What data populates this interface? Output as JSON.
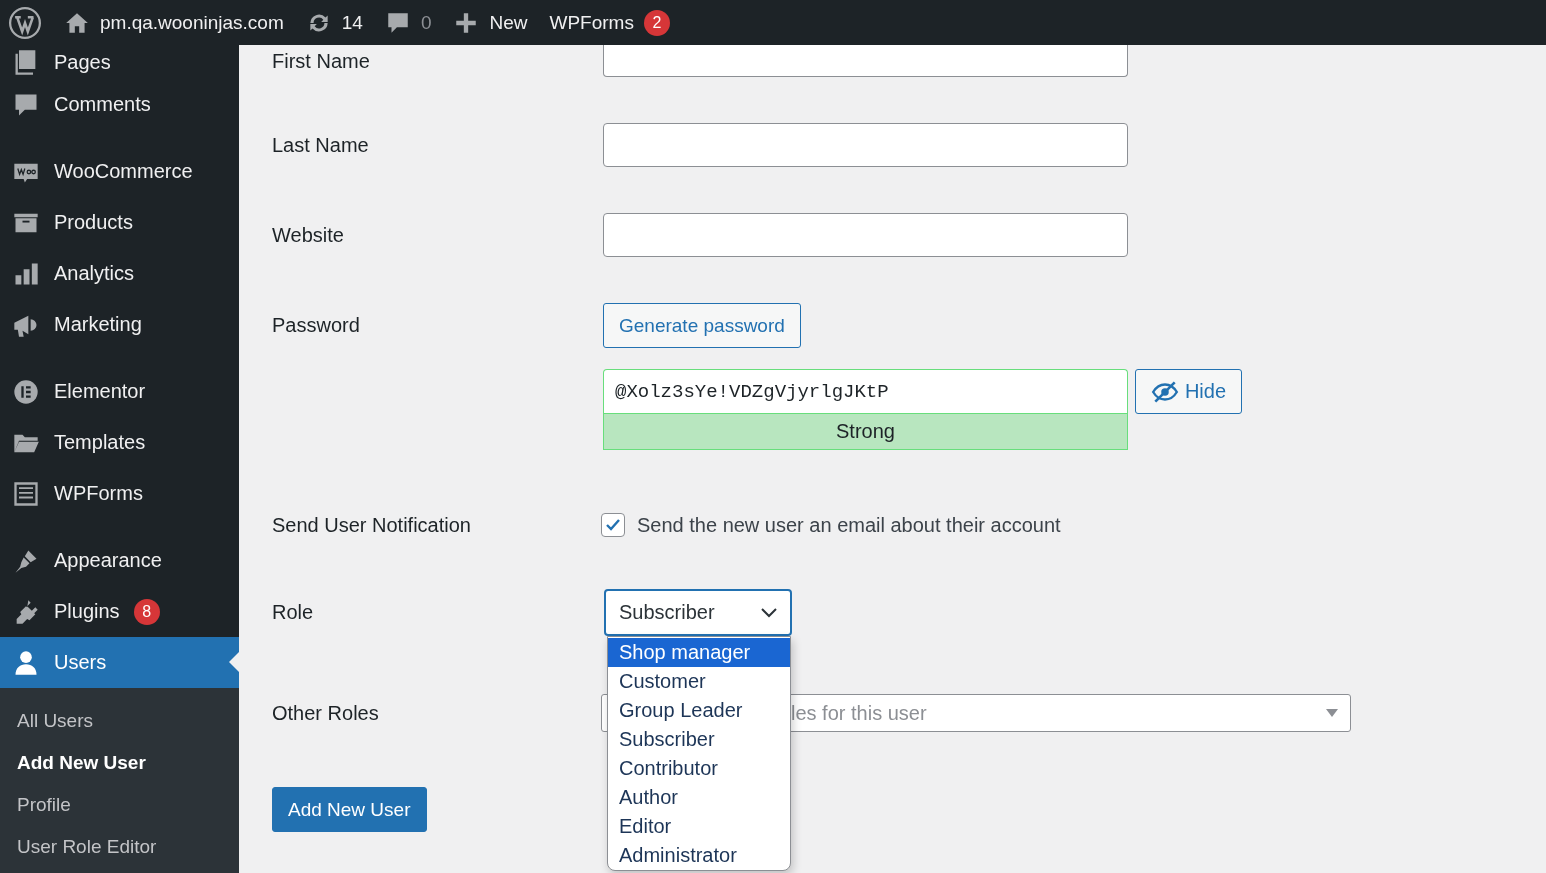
{
  "admin_bar": {
    "site": "pm.qa.wooninjas.com",
    "updates": "14",
    "comments": "0",
    "new": "New",
    "wpforms": "WPForms",
    "wpforms_badge": "2"
  },
  "sidebar": {
    "groups": [
      [
        {
          "label": "Pages",
          "selected": false
        },
        {
          "label": "Comments",
          "selected": false
        }
      ],
      [
        {
          "label": "WooCommerce",
          "selected": false
        },
        {
          "label": "Products",
          "selected": false
        },
        {
          "label": "Analytics",
          "selected": false
        },
        {
          "label": "Marketing",
          "selected": false
        }
      ],
      [
        {
          "label": "Elementor",
          "selected": false
        },
        {
          "label": "Templates",
          "selected": false
        },
        {
          "label": "WPForms",
          "selected": false
        }
      ],
      [
        {
          "label": "Appearance",
          "selected": false
        },
        {
          "label": "Plugins",
          "selected": false,
          "badge": "8"
        },
        {
          "label": "Users",
          "selected": true
        }
      ]
    ],
    "submenu": [
      {
        "label": "All Users",
        "selected": false
      },
      {
        "label": "Add New User",
        "selected": true
      },
      {
        "label": "Profile",
        "selected": false
      },
      {
        "label": "User Role Editor",
        "selected": false
      }
    ]
  },
  "form": {
    "first_name": {
      "label": "First Name"
    },
    "last_name": {
      "label": "Last Name"
    },
    "website": {
      "label": "Website"
    },
    "password": {
      "label": "Password",
      "generate_button": "Generate password",
      "value": "@Xolz3sYe!VDZgVjyrlgJKtP",
      "hide_button": "Hide",
      "strength": "Strong"
    },
    "notification": {
      "label": "Send User Notification",
      "text": "Send the new user an email about their account",
      "checked": true
    },
    "role": {
      "label": "Role",
      "value": "Subscriber",
      "expanded": true,
      "options": [
        {
          "label": "Shop manager",
          "highlighted": true
        },
        {
          "label": "Customer",
          "highlighted": false
        },
        {
          "label": "Group Leader",
          "highlighted": false
        },
        {
          "label": "Subscriber",
          "highlighted": false
        },
        {
          "label": "Contributor",
          "highlighted": false
        },
        {
          "label": "Author",
          "highlighted": false
        },
        {
          "label": "Editor",
          "highlighted": false
        },
        {
          "label": "Administrator",
          "highlighted": false
        }
      ]
    },
    "other_roles": {
      "label": "Other Roles",
      "placeholder": "les for this user"
    },
    "submit": "Add New User"
  }
}
